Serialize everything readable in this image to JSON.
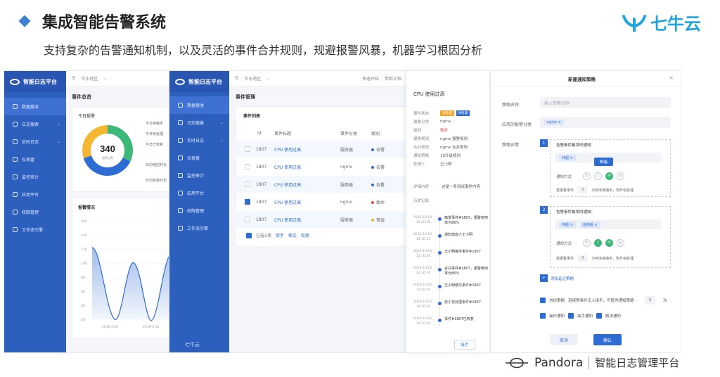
{
  "slide": {
    "title": "集成智能告警系统",
    "subtitle": "支持复杂的告警通知机制，以及灵活的事件合并规则，规避报警风暴，机器学习根因分析",
    "brand": "七牛云",
    "footer_product": "Pandora",
    "footer_tagline": "智能日志管理平台"
  },
  "app": {
    "name": "智能日志平台",
    "region": "华东地区",
    "nav": [
      "数据接收",
      "日志搜索",
      "实时日志",
      "仪表盘",
      "监控审计",
      "应用平台",
      "权限管理",
      "工作流引擎"
    ],
    "quick_start": "快速开始",
    "docs": "帮助文档",
    "watermark": "七牛云"
  },
  "overview": {
    "title": "事件总览",
    "today_title": "今日报警",
    "total": "340",
    "total_label": "报警总数",
    "stats": [
      "今日待接手",
      "今日待处理",
      "今日已恢复",
      "日均响应时长",
      "日均恢复时长"
    ],
    "trend_title": "报警情况",
    "y_ticks": [
      "160",
      "140",
      "120",
      "100",
      "80",
      "60",
      "40",
      "20"
    ],
    "x_ticks": [
      "2016-9-26",
      "2016-3-15"
    ],
    "donut": [
      {
        "value": 0.32,
        "color": "#3cb878"
      },
      {
        "value": 0.38,
        "color": "#2d6cd3"
      },
      {
        "value": 0.3,
        "color": "#f5b731"
      }
    ]
  },
  "events": {
    "title": "事件管理",
    "list_title": "事件列表",
    "columns": [
      "Id",
      "事件标题",
      "事件分类",
      "级别"
    ],
    "rows": [
      {
        "id": "1807",
        "title": "CPU 使用过高",
        "category": "服务器",
        "level": "告警",
        "color": "#2d6cd3",
        "checked": false,
        "highlight": true
      },
      {
        "id": "1807",
        "title": "CPU 使用过高",
        "category": "nginx",
        "level": "告警",
        "color": "#2d6cd3",
        "checked": false,
        "highlight": false
      },
      {
        "id": "1807",
        "title": "CPU 使用过高",
        "category": "服务器",
        "level": "告警",
        "color": "#2d6cd3",
        "checked": false,
        "highlight": true
      },
      {
        "id": "1807",
        "title": "CPU 使用过高",
        "category": "nginx",
        "level": "致命",
        "color": "#e5484d",
        "checked": true,
        "highlight": false
      },
      {
        "id": "1807",
        "title": "CPU 使用过高",
        "category": "服务器",
        "level": "错误",
        "color": "#f5a623",
        "checked": false,
        "highlight": true
      }
    ],
    "selected_text": "已选1项",
    "actions": [
      "接手",
      "移交",
      "恢复"
    ]
  },
  "detail": {
    "title": "CPU 使用过高",
    "fields": [
      {
        "k": "事件状态",
        "v": ""
      },
      {
        "k": "报警分类",
        "v": "nginx"
      },
      {
        "k": "级别",
        "v": "致命"
      },
      {
        "k": "报警规则",
        "v": "nginx 报警规则"
      },
      {
        "k": "合并规则",
        "v": "nginx 合并规则"
      },
      {
        "k": "通知策略",
        "v": "10升级规则"
      },
      {
        "k": "处理人",
        "v": "王小明"
      }
    ],
    "status_tags": [
      "待处理",
      "待处理"
    ],
    "content_label": "详细内容",
    "content_value": "这是一条测试事件内容",
    "history_label": "历史记录",
    "history": [
      {
        "date": "2016-10-10",
        "time": "12:30:30",
        "text": "触发事件#1807，报警使用率为86%"
      },
      {
        "date": "2016-10-10",
        "time": "12:30:30",
        "text": "通知值班人王小明"
      },
      {
        "date": "2016-10-10",
        "time": "12:30:30",
        "text": "王小明接手事件#1807"
      },
      {
        "date": "2016-10-10",
        "time": "12:30:30",
        "text": "合并事件#1807，报警使用率为86%"
      },
      {
        "date": "2016-10-10",
        "time": "12:30:30",
        "text": "王小明移交事件#1807"
      },
      {
        "date": "2016-10-10",
        "time": "12:30:30",
        "text": "张小花处理事件#1807"
      },
      {
        "date": "2016-10-10",
        "time": "12:30:30",
        "text": "事件#1807已恢复"
      }
    ],
    "btn_take": "接手",
    "btn_more": "移交"
  },
  "policy": {
    "title": "新建通知策略",
    "name_label": "策略名称",
    "name_placeholder": "输入策略名称",
    "cat_label": "应用的报警分类",
    "cat_tag": "nginx",
    "detail_label": "策略详情",
    "step1_trigger": "告警事件触发时通知：",
    "step1_person": "仲超",
    "tooltip": "邮箱",
    "notify_label": "通知方式",
    "condition_label": "若报警事件",
    "condition_minutes": "3",
    "condition_text": "分钟未被接手，则升级处理",
    "step2_trigger": "告警事件触发时通知：",
    "step2_people": [
      "仲超",
      "运维组"
    ],
    "add_step": "添加延迟策略",
    "silence_label": "勿扰策略",
    "silence_text": "若报警事件无人接手，可暂停通知策略",
    "silence_value": "3",
    "silence_unit": "次",
    "op_label": "操作通知",
    "op_take": "接手通知",
    "op_resolve": "解决通知",
    "cancel": "取消",
    "confirm": "确认"
  }
}
